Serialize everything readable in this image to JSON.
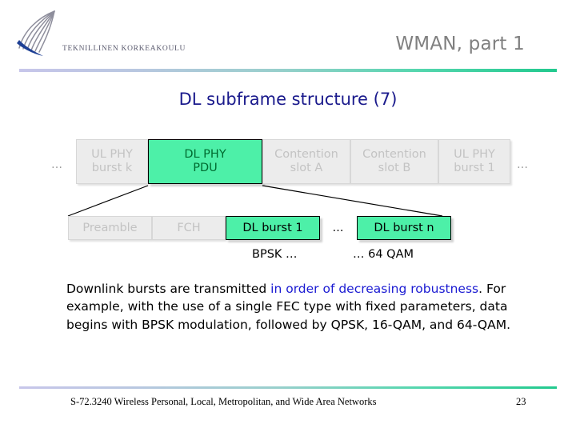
{
  "header": {
    "logo_alt": "tkk-logo",
    "wordmark": "TEKNILLINEN KORKEAKOULU",
    "title": "WMAN, part 1",
    "title_color": "#808080",
    "rule_gradient_from": "#c7c6ea",
    "rule_gradient_to": "#22c98e"
  },
  "subtitle": {
    "text": "DL subframe structure (7)",
    "color": "#1a1a8c"
  },
  "diagram": {
    "highlight_color": "#4df0a8",
    "dim_color": "#ececec",
    "dim_text_color": "#c3c3c3",
    "left_ellipsis": "…",
    "right_ellipsis": "…",
    "row1": [
      {
        "label": "UL PHY\nburst k",
        "line1": "UL PHY",
        "line2": "burst k",
        "state": "dim"
      },
      {
        "label": "DL PHY\nPDU",
        "line1": "DL PHY",
        "line2": "PDU",
        "state": "highlight"
      },
      {
        "label": "Contention\nslot A",
        "line1": "Contention",
        "line2": "slot A",
        "state": "dim"
      },
      {
        "label": "Contention\nslot B",
        "line1": "Contention",
        "line2": "slot B",
        "state": "dim"
      },
      {
        "label": "UL PHY\nburst 1",
        "line1": "UL PHY",
        "line2": "burst 1",
        "state": "dim"
      }
    ],
    "row2": [
      {
        "label": "Preamble",
        "state": "dim"
      },
      {
        "label": "FCH",
        "state": "dim"
      },
      {
        "label": "DL burst 1",
        "state": "highlight"
      },
      {
        "label": "DL burst n",
        "state": "highlight"
      }
    ],
    "row2_inner_ellipsis": "…"
  },
  "modulation": {
    "left": "BPSK  …",
    "right": "…  64 QAM"
  },
  "body": {
    "seg1": "Downlink bursts are transmitted ",
    "seg2_accent": "in order of decreasing robustness",
    "seg3": ". For example, with the use of a single FEC type with fixed parameters, data begins with BPSK modulation, followed by QPSK, 16-QAM, and 64-QAM.",
    "accent_color": "#1a1ad2"
  },
  "footer": {
    "course": "S-72.3240 Wireless Personal, Local, Metropolitan, and Wide Area Networks",
    "page": "23"
  }
}
